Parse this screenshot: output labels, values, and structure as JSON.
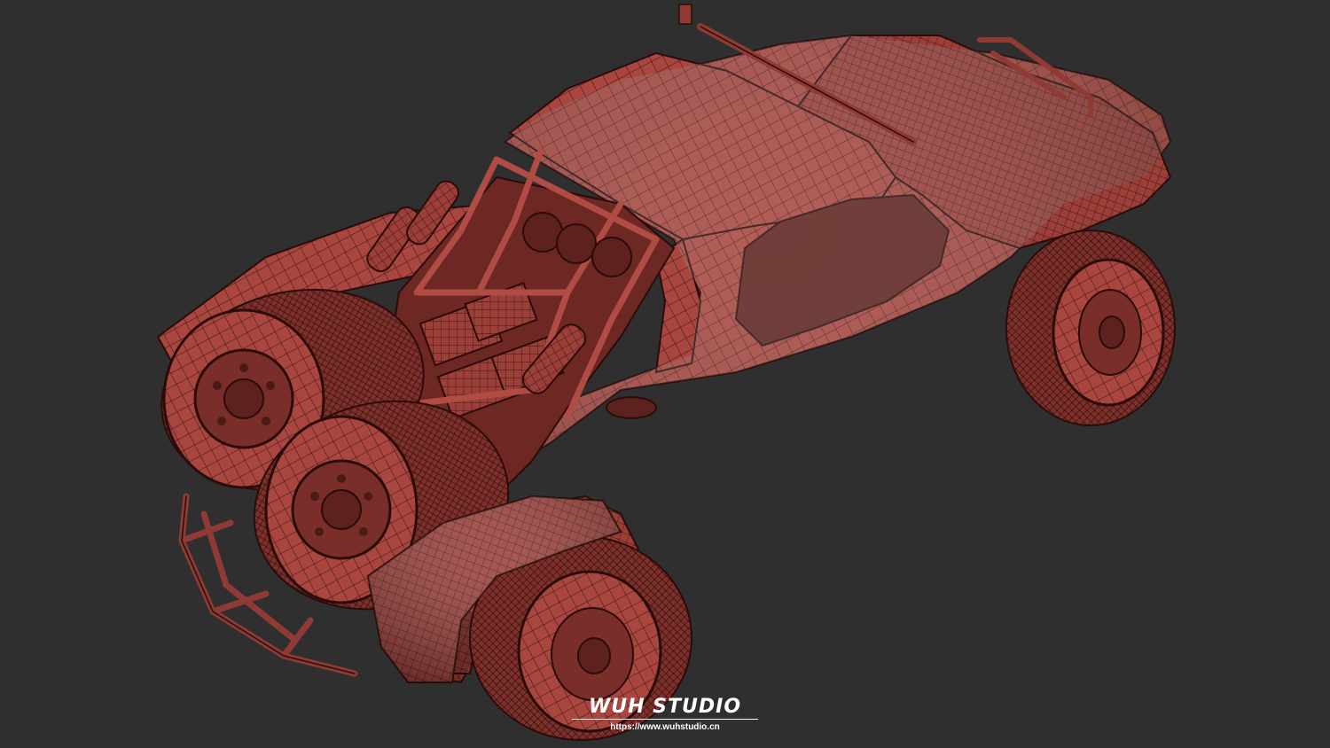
{
  "scene": {
    "subject": "wireframe off-road buggy render",
    "background_color": "#2f2f2f",
    "mesh_fill_color": "#a8463f",
    "mesh_line_color": "#3a1210",
    "mesh_highlight_color": "#c0574e"
  },
  "watermark": {
    "logo_text": "WUH STUDIO",
    "url": "https://www.wuhstudio.cn"
  }
}
